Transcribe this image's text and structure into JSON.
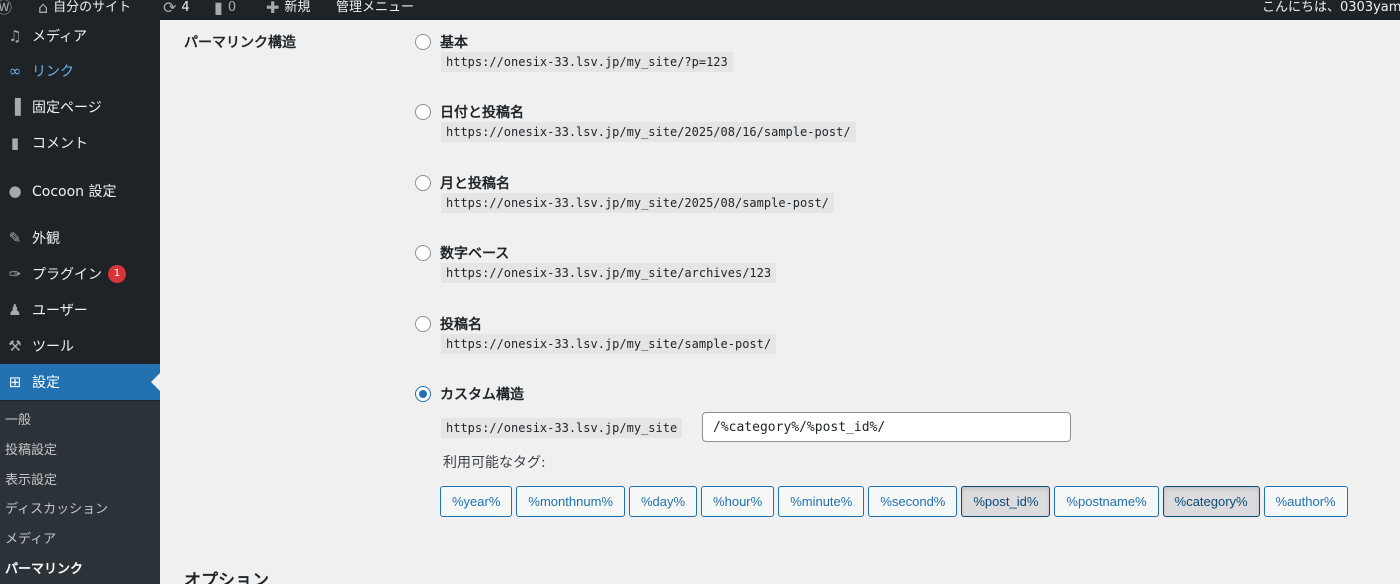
{
  "adminbar": {
    "site_name": "自分のサイト",
    "updates_count": "4",
    "comments_count": "0",
    "new_label": "新規",
    "admin_menu_label": "管理メニュー",
    "greeting": "こんにちは、0303yam"
  },
  "sidebar": {
    "items": [
      {
        "label": "メディア",
        "icon": "media-icon"
      },
      {
        "label": "リンク",
        "icon": "link-icon"
      },
      {
        "label": "固定ページ",
        "icon": "page-icon"
      },
      {
        "label": "コメント",
        "icon": "comment-icon"
      },
      {
        "label": "Cocoon 設定",
        "icon": "circle-icon"
      },
      {
        "label": "外観",
        "icon": "appearance-icon"
      },
      {
        "label": "プラグイン",
        "icon": "plugin-icon",
        "badge": "1"
      },
      {
        "label": "ユーザー",
        "icon": "user-icon"
      },
      {
        "label": "ツール",
        "icon": "tools-icon"
      },
      {
        "label": "設定",
        "icon": "settings-icon"
      }
    ],
    "submenu": [
      "一般",
      "投稿設定",
      "表示設定",
      "ディスカッション",
      "メディア",
      "パーマリンク"
    ]
  },
  "main": {
    "section_label": "パーマリンク構造",
    "options": [
      {
        "label": "基本",
        "url": "https://onesix-33.lsv.jp/my_site/?p=123",
        "checked": false
      },
      {
        "label": "日付と投稿名",
        "url": "https://onesix-33.lsv.jp/my_site/2025/08/16/sample-post/",
        "checked": false
      },
      {
        "label": "月と投稿名",
        "url": "https://onesix-33.lsv.jp/my_site/2025/08/sample-post/",
        "checked": false
      },
      {
        "label": "数字ベース",
        "url": "https://onesix-33.lsv.jp/my_site/archives/123",
        "checked": false
      },
      {
        "label": "投稿名",
        "url": "https://onesix-33.lsv.jp/my_site/sample-post/",
        "checked": false
      },
      {
        "label": "カスタム構造",
        "url": "https://onesix-33.lsv.jp/my_site",
        "checked": true
      }
    ],
    "custom_structure_value": "/%category%/%post_id%/",
    "available_tags_label": "利用可能なタグ:",
    "tags": [
      {
        "label": "%year%",
        "active": false
      },
      {
        "label": "%monthnum%",
        "active": false
      },
      {
        "label": "%day%",
        "active": false
      },
      {
        "label": "%hour%",
        "active": false
      },
      {
        "label": "%minute%",
        "active": false
      },
      {
        "label": "%second%",
        "active": false
      },
      {
        "label": "%post_id%",
        "active": true
      },
      {
        "label": "%postname%",
        "active": false
      },
      {
        "label": "%category%",
        "active": true
      },
      {
        "label": "%author%",
        "active": false
      }
    ],
    "options_heading": "オプション"
  }
}
